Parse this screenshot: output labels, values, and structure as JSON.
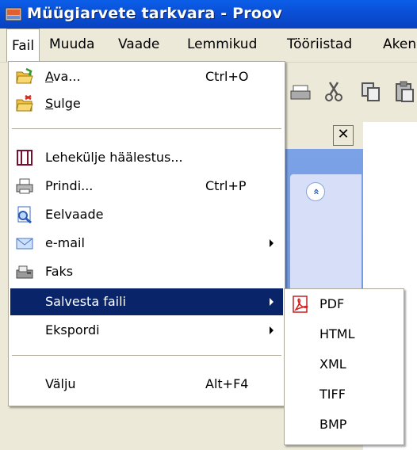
{
  "window": {
    "title": "Müügiarvete tarkvara - Proov"
  },
  "menubar": {
    "items": [
      {
        "label": "Fail",
        "active": true
      },
      {
        "label": "Muuda"
      },
      {
        "label": "Vaade"
      },
      {
        "label": "Lemmikud"
      },
      {
        "label": "Tööriistad"
      },
      {
        "label": "Aken"
      }
    ]
  },
  "fail_menu": {
    "items": [
      {
        "label_pre": "",
        "label_u": "A",
        "label_post": "va...",
        "shortcut": "Ctrl+O",
        "icon": "open-folder-icon"
      },
      {
        "label_pre": "",
        "label_u": "S",
        "label_post": "ulge",
        "shortcut": "",
        "icon": "close-folder-icon"
      },
      {
        "label": "Lehekülje häälestus...",
        "shortcut": "",
        "icon": "page-setup-icon"
      },
      {
        "label": "Prindi...",
        "shortcut": "Ctrl+P",
        "icon": "printer-icon"
      },
      {
        "label": "Eelvaade",
        "shortcut": "",
        "icon": "preview-icon"
      },
      {
        "label": "e-mail",
        "shortcut": "",
        "icon": "envelope-icon",
        "submenu": true
      },
      {
        "label": "Faks",
        "shortcut": "",
        "icon": "fax-icon"
      },
      {
        "label": "Salvesta faili",
        "shortcut": "",
        "submenu": true,
        "selected": true
      },
      {
        "label": "Ekspordi",
        "shortcut": "",
        "submenu": true
      },
      {
        "label": "Välju",
        "shortcut": "Alt+F4"
      }
    ]
  },
  "save_submenu": {
    "items": [
      {
        "label": "PDF",
        "icon": "pdf-icon"
      },
      {
        "label": "HTML"
      },
      {
        "label": "XML"
      },
      {
        "label": "TIFF"
      },
      {
        "label": "BMP"
      }
    ]
  },
  "panel": {
    "close_glyph": "✕",
    "collapse_glyph": "«"
  },
  "colors": {
    "title_bar": "#0a4fd6",
    "menu_highlight": "#0a246a",
    "task_panel": "#7ba2e7"
  }
}
